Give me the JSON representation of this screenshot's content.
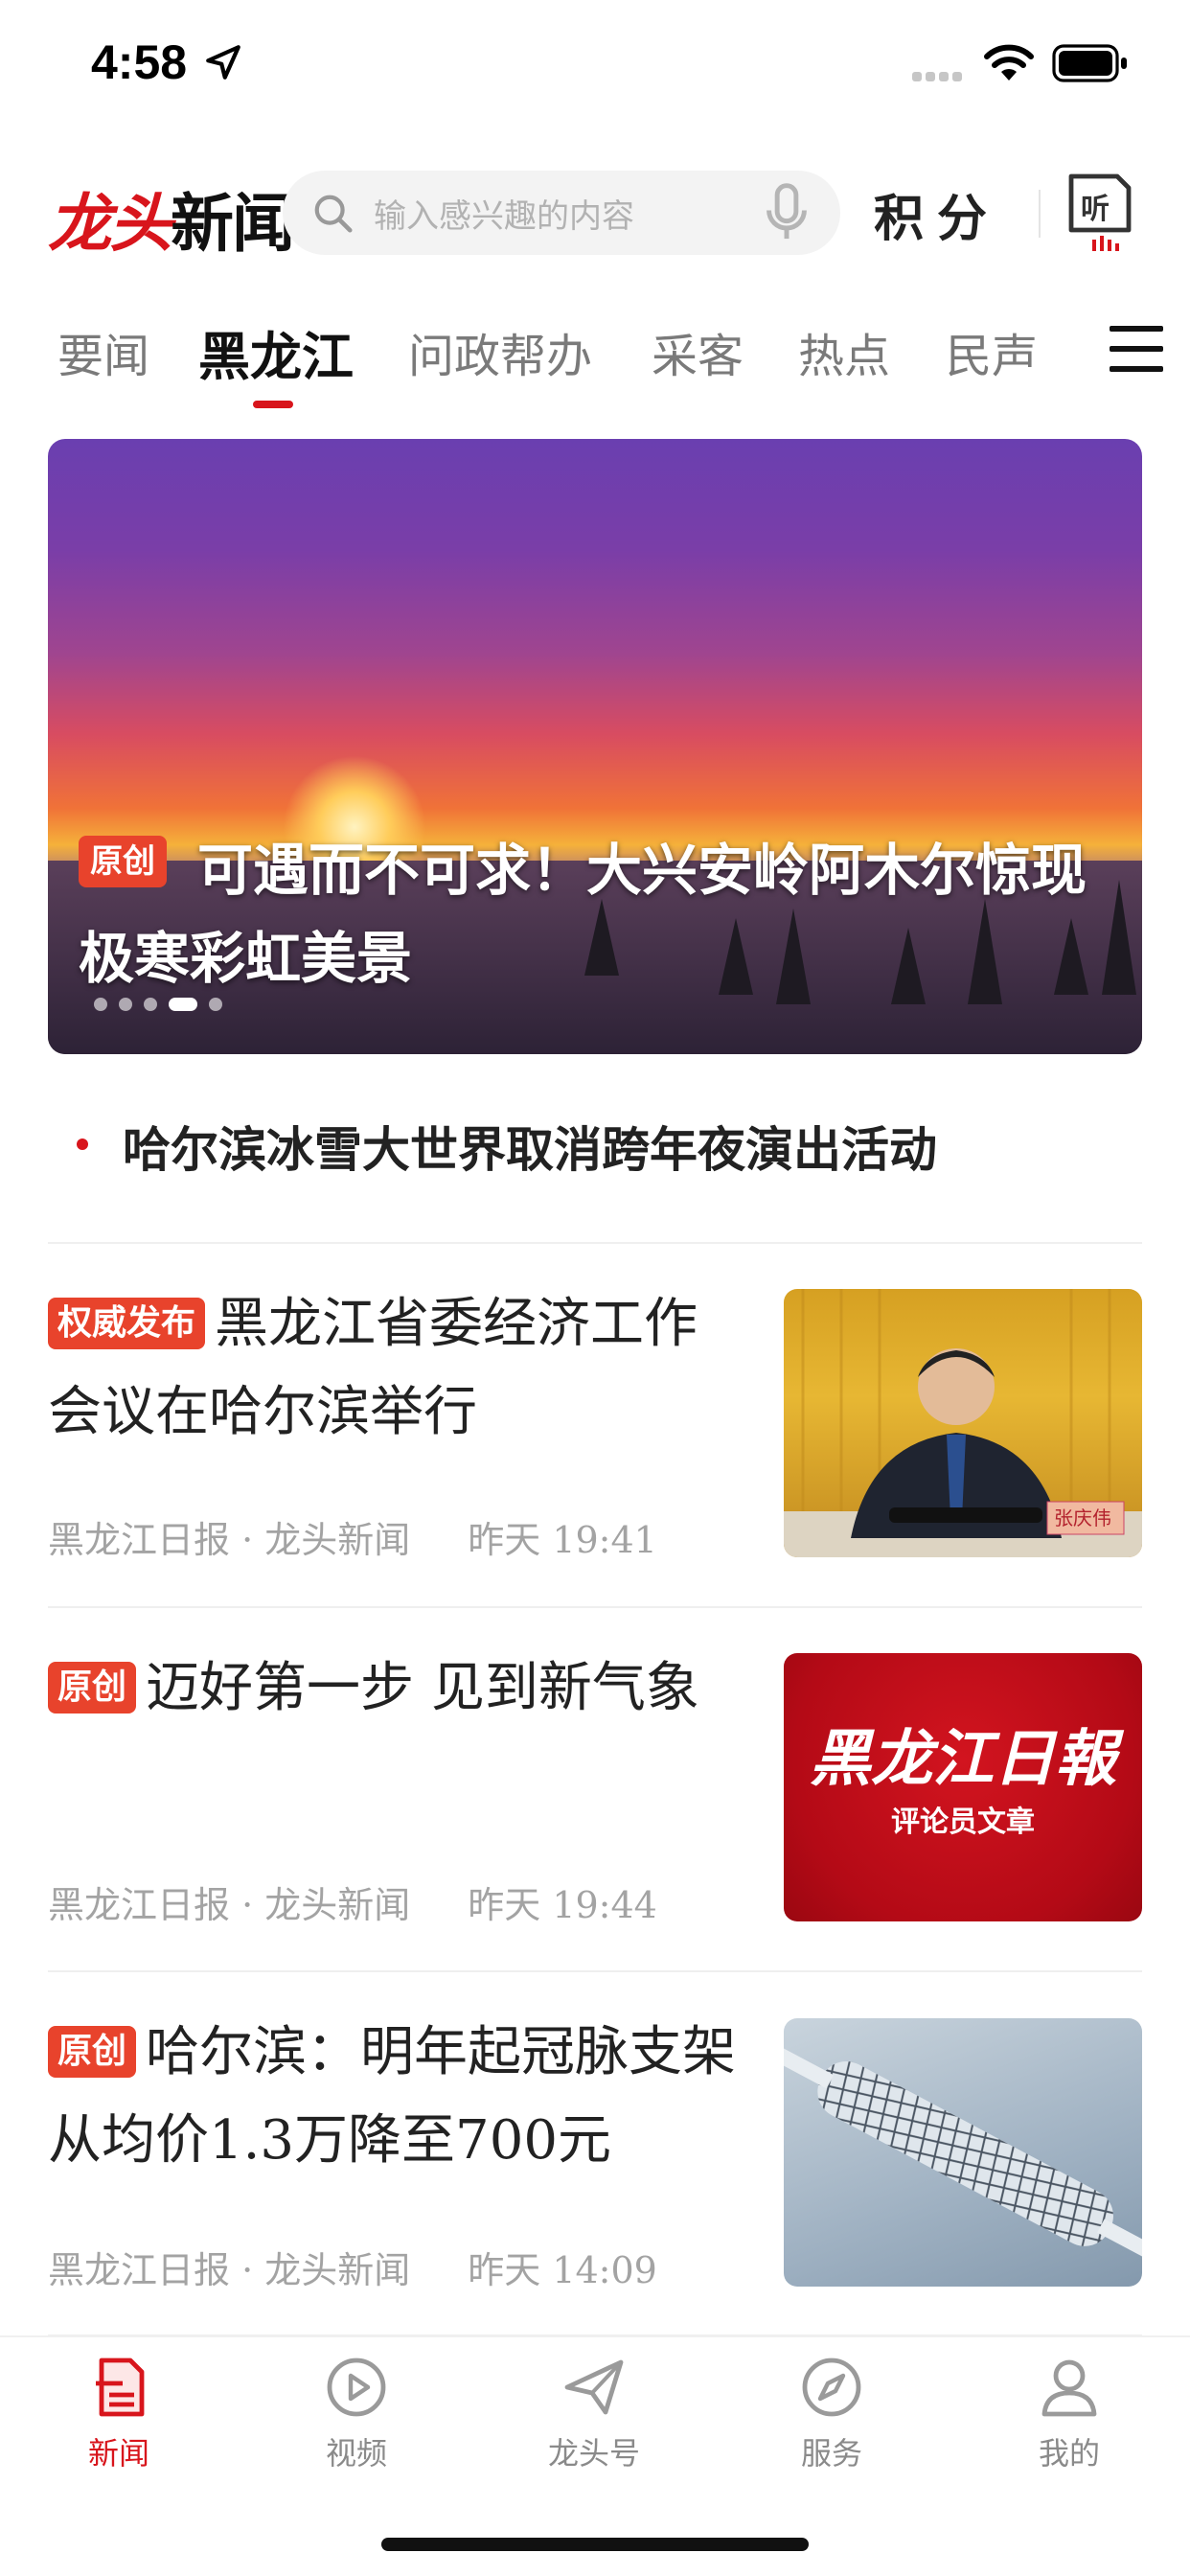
{
  "status_bar": {
    "time": "4:58"
  },
  "header": {
    "logo_red": "龙头",
    "logo_black": "新闻",
    "search_placeholder": "输入感兴趣的内容",
    "points_label": "积分"
  },
  "tabs": [
    {
      "label": "要闻"
    },
    {
      "label": "黑龙江",
      "active": true
    },
    {
      "label": "问政帮办"
    },
    {
      "label": "采客"
    },
    {
      "label": "热点"
    },
    {
      "label": "民声"
    }
  ],
  "hero": {
    "tag": "原创",
    "title": "可遇而不可求！大兴安岭阿木尔惊现极寒彩虹美景",
    "slide_count": 5,
    "active_slide": 4
  },
  "headline": "哈尔滨冰雪大世界取消跨年夜演出活动",
  "news": [
    {
      "tag": "权威发布",
      "title": "黑龙江省委经济工作会议在哈尔滨举行",
      "source": "黑龙江日报 · 龙头新闻",
      "time": "昨天  19:41",
      "thumb_caption": "张庆伟"
    },
    {
      "tag": "原创",
      "title": "迈好第一步 见到新气象",
      "source": "黑龙江日报 · 龙头新闻",
      "time": "昨天  19:44",
      "thumb_title": "黑龙江日報",
      "thumb_subtitle": "评论员文章"
    },
    {
      "tag": "原创",
      "title": "哈尔滨：明年起冠脉支架从均价1.3万降至700元",
      "source": "黑龙江日报 · 龙头新闻",
      "time": "昨天  14:09"
    }
  ],
  "bottom_nav": [
    {
      "label": "新闻",
      "icon": "news-icon",
      "active": true
    },
    {
      "label": "视频",
      "icon": "video-icon"
    },
    {
      "label": "龙头号",
      "icon": "paper-plane-icon"
    },
    {
      "label": "服务",
      "icon": "compass-icon"
    },
    {
      "label": "我的",
      "icon": "profile-icon"
    }
  ],
  "colors": {
    "accent": "#d8151c",
    "tag": "#e8432c"
  }
}
